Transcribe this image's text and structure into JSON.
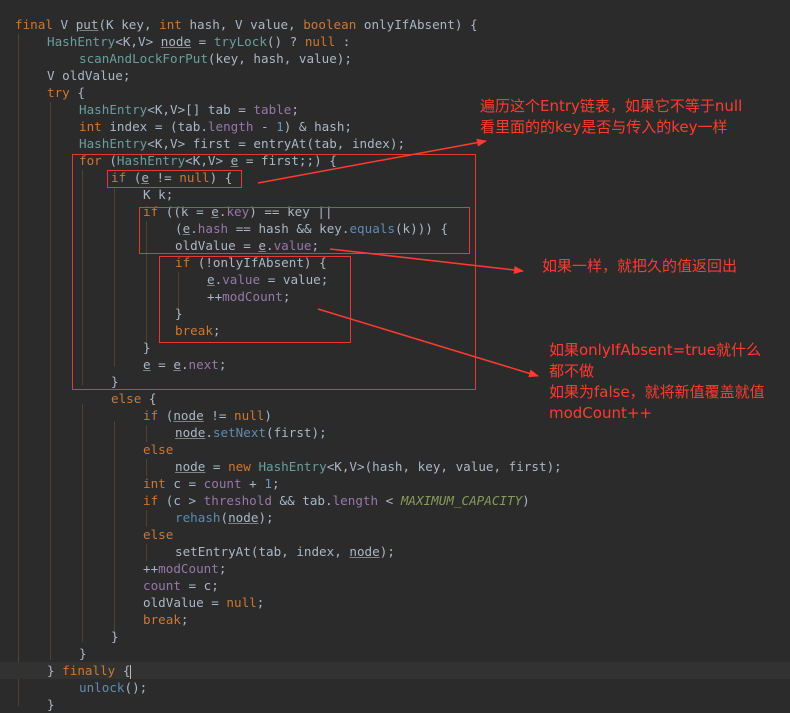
{
  "code": {
    "signature": {
      "kw_final": "final",
      "ret_type": "V",
      "method": "put",
      "params": "(K key, ",
      "kw_int": "int",
      "params2": " hash, V value, ",
      "kw_boolean": "boolean",
      "params3": " onlyIfAbsent) {"
    },
    "l2": {
      "type": "HashEntry",
      "generic": "<K,V> ",
      "var": "node",
      "mid": " = ",
      "call": "tryLock",
      "tail1": "() ? ",
      "kw_null": "null",
      "tail2": " :"
    },
    "l3": {
      "call": "scanAndLockForPut",
      "args": "(key, hash, value);"
    },
    "l4": {
      "text": "V oldValue;"
    },
    "l5": {
      "kw_try": "try",
      "brace": " {"
    },
    "l6": {
      "type": "HashEntry",
      "generic": "<K,V>[] tab = ",
      "fld": "table",
      "semi": ";"
    },
    "l7": {
      "kw_int": "int",
      "a": " index = (tab.",
      "fld": "length",
      "b": " - ",
      "num": "1",
      "c": ") & hash;"
    },
    "l8": {
      "type": "HashEntry",
      "generic": "<K,V> first = entryAt(tab, index);"
    },
    "l9": {
      "kw_for": "for",
      "a": " (",
      "type": "HashEntry",
      "b": "<K,V> ",
      "var": "e",
      "c": " = first;;) {"
    },
    "l10": {
      "kw_if": "if",
      "a": " (",
      "var": "e",
      "b": " != ",
      "kw_null": "null",
      "c": ") {"
    },
    "l11": {
      "text": "K k;"
    },
    "l12": {
      "kw_if": "if",
      "a": " ((k = ",
      "var": "e",
      "dot": ".",
      "fld": "key",
      "b": ") == key ||"
    },
    "l13": {
      "a": "(",
      "var": "e",
      "dot": ".",
      "fld": "hash",
      "b": " == hash && key.",
      "mth": "equals",
      "c": "(k))) {"
    },
    "l14": {
      "a": "oldValue = ",
      "var": "e",
      "dot": ".",
      "fld": "value",
      "b": ";"
    },
    "l15": {
      "kw_if": "if",
      "a": " (!onlyIfAbsent) {"
    },
    "l16": {
      "var": "e",
      "dot": ".",
      "fld": "value",
      "a": " = value;"
    },
    "l17": {
      "a": "++",
      "fld": "modCount",
      "b": ";"
    },
    "l18": {
      "text": "}"
    },
    "l19": {
      "kw": "break",
      "semi": ";"
    },
    "l20": {
      "text": "}"
    },
    "l21": {
      "var": "e",
      "a": " = ",
      "var2": "e",
      "dot": ".",
      "fld": "next",
      "b": ";"
    },
    "l22": {
      "text": "}"
    },
    "l23": {
      "kw_else": "else",
      "a": " {"
    },
    "l24": {
      "kw_if": "if",
      "a": " (",
      "var": "node",
      "b": " != ",
      "kw_null": "null",
      "c": ")"
    },
    "l25": {
      "var": "node",
      "dot": ".",
      "mth": "setNext",
      "a": "(first);"
    },
    "l26": {
      "kw_else": "else"
    },
    "l27": {
      "var": "node",
      "a": " = ",
      "kw_new": "new",
      "sp": " ",
      "type": "HashEntry",
      "b": "<K,V>(hash, key, value, first);"
    },
    "l28": {
      "kw_int": "int",
      "a": " c = ",
      "fld": "count",
      "b": " + ",
      "num": "1",
      "c": ";"
    },
    "l29": {
      "kw_if": "if",
      "a": " (c > ",
      "fld": "threshold",
      "b": " && tab.",
      "fld2": "length",
      "c": " < ",
      "cst": "MAXIMUM_CAPACITY",
      "d": ")"
    },
    "l30": {
      "mth": "rehash",
      "a": "(",
      "var": "node",
      "b": ");"
    },
    "l31": {
      "kw_else": "else"
    },
    "l32": {
      "a": "setEntryAt(tab, index, ",
      "var": "node",
      "b": ");"
    },
    "l33": {
      "a": "++",
      "fld": "modCount",
      "b": ";"
    },
    "l34": {
      "fld": "count",
      "a": " = c;"
    },
    "l35": {
      "a": "oldValue = ",
      "kw_null": "null",
      "b": ";"
    },
    "l36": {
      "kw": "break",
      "semi": ";"
    },
    "l37": {
      "text": "}"
    },
    "l38": {
      "text": "}"
    },
    "l39": {
      "a": "} ",
      "kw_finally": "finally",
      "b": " {"
    },
    "l40": {
      "mth": "unlock",
      "a": "();"
    },
    "l41": {
      "text": "}"
    }
  },
  "annotations": {
    "note1": "遍历这个Entry链表，如果它不等于null\n看里面的的key是否与传入的key一样",
    "note2": "如果一样，就把久的值返回出",
    "note3": "如果onlyIfAbsent=true就什么\n都不做\n如果为false，就将新值覆盖就值\nmodCount++"
  },
  "colors": {
    "background": "#2b2b2b",
    "keyword": "#cc7832",
    "type": "#6a9e9c",
    "field": "#9876aa",
    "annotation": "#ff3b30"
  }
}
